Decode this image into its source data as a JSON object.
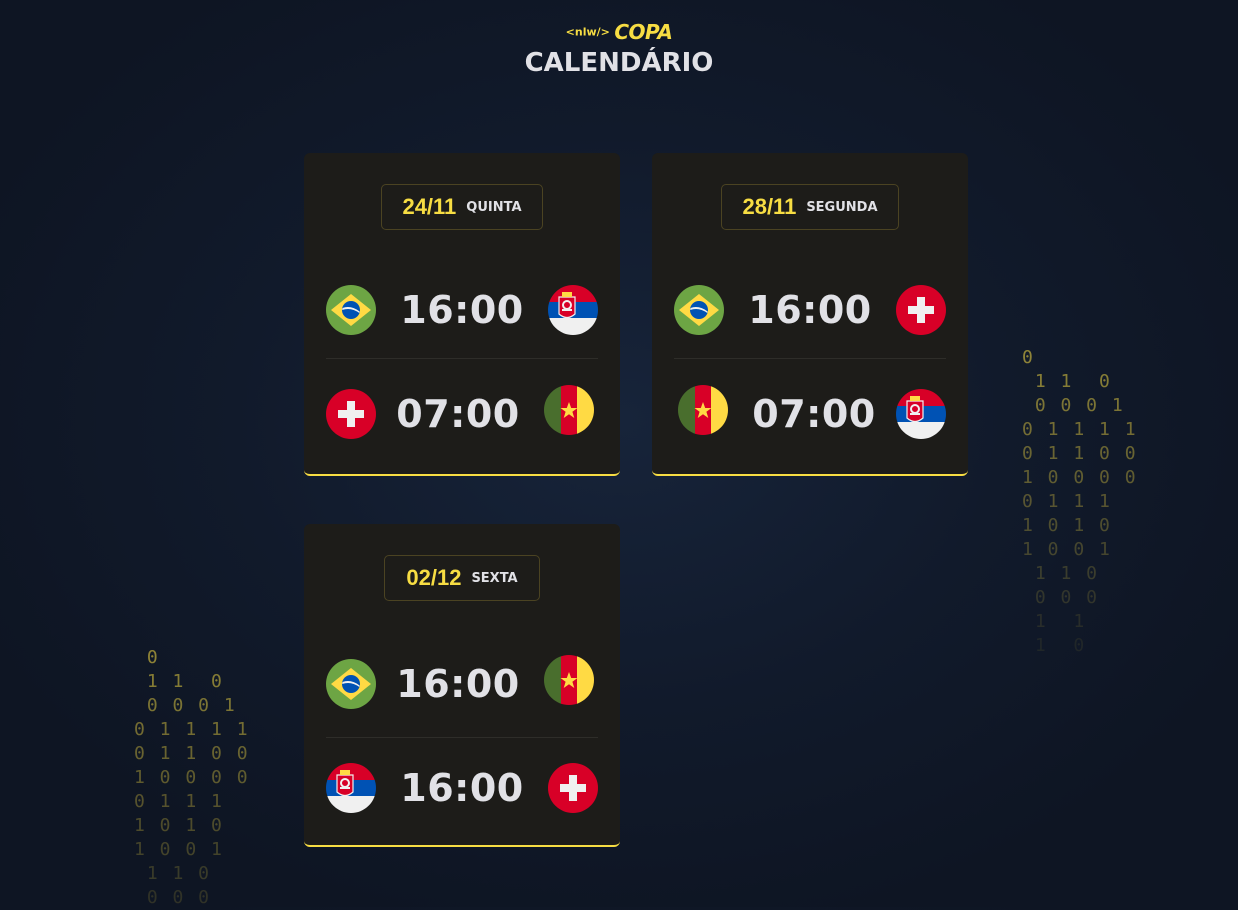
{
  "header": {
    "logo_tag": "<nlw/>",
    "logo_word": "COPA",
    "title": "CALENDÁRIO"
  },
  "cards": [
    {
      "date": "24/11",
      "weekday": "QUINTA",
      "games": [
        {
          "home": "brazil",
          "time": "16:00",
          "away": "serbia"
        },
        {
          "home": "switzerland",
          "time": "07:00",
          "away": "cameroon"
        }
      ]
    },
    {
      "date": "28/11",
      "weekday": "SEGUNDA",
      "games": [
        {
          "home": "brazil",
          "time": "16:00",
          "away": "switzerland"
        },
        {
          "home": "cameroon",
          "time": "07:00",
          "away": "serbia"
        }
      ]
    },
    {
      "date": "02/12",
      "weekday": "SEXTA",
      "games": [
        {
          "home": "brazil",
          "time": "16:00",
          "away": "cameroon"
        },
        {
          "home": "serbia",
          "time": "16:00",
          "away": "switzerland"
        }
      ]
    }
  ],
  "decor": {
    "binary_right": [
      "0",
      " 11 0",
      " 0001",
      "01111",
      "01100",
      "10000",
      "0111",
      "1010",
      "1001",
      " 110",
      " 000",
      " 1 1",
      " 1 0"
    ],
    "binary_left": [
      " 0",
      " 11 0",
      " 0001",
      "01111",
      "01100",
      "10000",
      "0111",
      "1010",
      "1001",
      " 110",
      " 000"
    ]
  },
  "colors": {
    "accent": "#f7dd43",
    "card_bg": "#1d1c19",
    "text": "#e1e1e6"
  }
}
